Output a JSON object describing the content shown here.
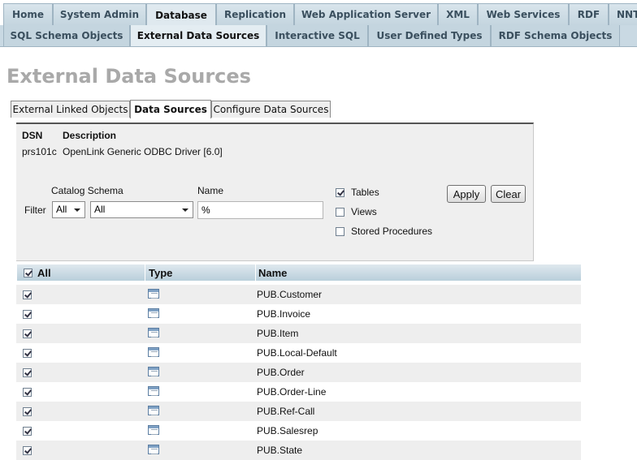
{
  "nav_primary": [
    "Home",
    "System Admin",
    "Database",
    "Replication",
    "Web Application Server",
    "XML",
    "Web Services",
    "RDF",
    "NNTP"
  ],
  "nav_secondary": [
    "SQL Schema Objects",
    "External Data Sources",
    "Interactive SQL",
    "User Defined Types",
    "RDF Schema Objects"
  ],
  "page_title": "External Data Sources",
  "sub_tabs": [
    "External Linked Objects",
    "Data Sources",
    "Configure Data Sources"
  ],
  "dsn_panel": {
    "dsn_header": "DSN",
    "description_header": "Description",
    "dsn_value": "prs101c",
    "description_value": "OpenLink Generic ODBC Driver [6.0]"
  },
  "filter": {
    "filter_label": "Filter",
    "catalog_schema_label": "Catalog Schema",
    "catalog_value": "All",
    "schema_value": "All",
    "name_label": "Name",
    "name_value": "%",
    "tables_label": "Tables",
    "tables_checked": true,
    "views_label": "Views",
    "views_checked": false,
    "procedures_label": "Stored Procedures",
    "procedures_checked": false,
    "apply_label": "Apply",
    "clear_label": "Clear"
  },
  "table": {
    "col_all": "All",
    "col_type": "Type",
    "col_name": "Name",
    "rows": [
      "PUB.Customer",
      "PUB.Invoice",
      "PUB.Item",
      "PUB.Local-Default",
      "PUB.Order",
      "PUB.Order-Line",
      "PUB.Ref-Call",
      "PUB.Salesrep",
      "PUB.State"
    ]
  }
}
